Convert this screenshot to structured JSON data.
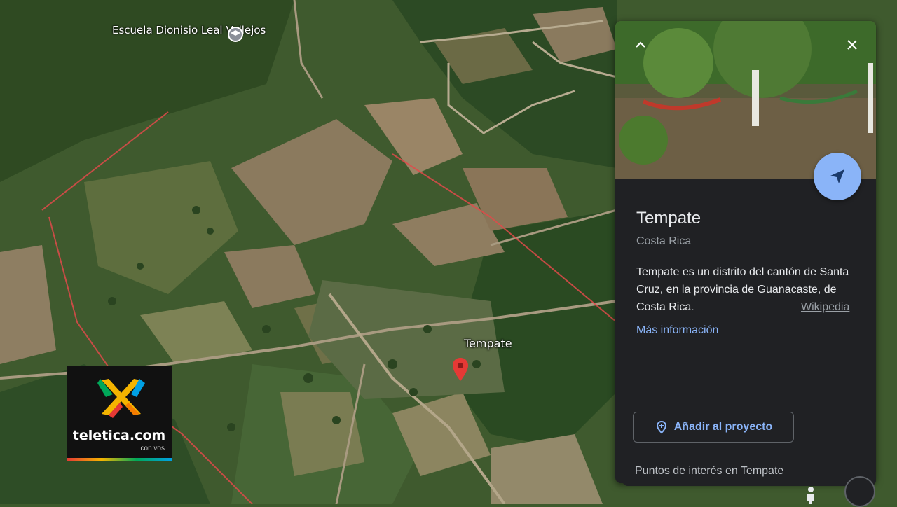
{
  "map": {
    "poi_label": "Escuela Dionisio Leal Vallejos",
    "poi_icon": "school-icon",
    "town_label": "Tempate",
    "pin_icon": "map-pin-icon"
  },
  "panel": {
    "collapse_icon": "chevron-up-icon",
    "close_icon": "close-icon",
    "send_icon": "send-icon",
    "title": "Tempate",
    "subtitle": "Costa Rica",
    "description_main": "Tempate es un distrito del cantón de Santa Cruz, en la provincia de Guanacaste, de Costa Rica",
    "description_fade": ".",
    "source_link": "Wikipedia",
    "more_info": "Más información",
    "add_button": "Añadir al proyecto",
    "points_of_interest": "Puntos de interés en Tempate",
    "accent_color": "#8ab4f8"
  },
  "controls": {
    "pegman_icon": "pegman-icon",
    "compass_icon": "compass-icon"
  },
  "watermark": {
    "brand": "teletica.com",
    "tagline": "con vos"
  }
}
